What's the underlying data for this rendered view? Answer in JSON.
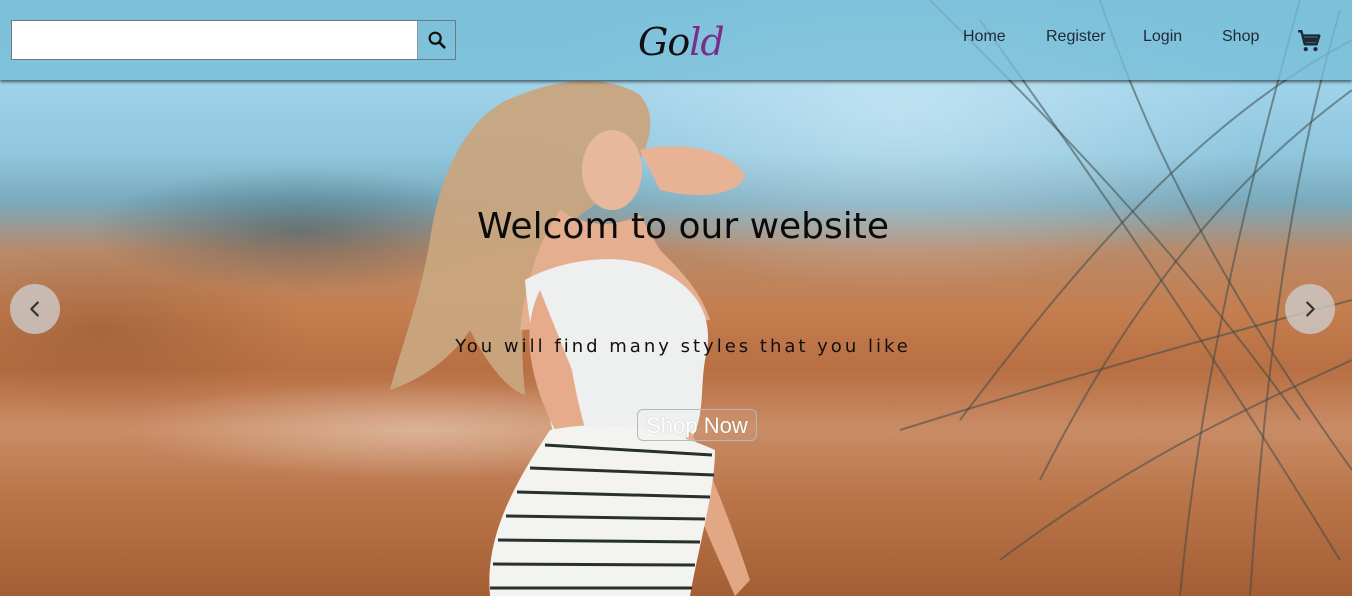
{
  "header": {
    "search": {
      "value": "",
      "placeholder": "",
      "button_icon": "search-icon"
    },
    "logo": {
      "part1": "Go",
      "part2": "ld",
      "colors": {
        "part1": "#111111",
        "part2": "#7b2d8c"
      }
    },
    "nav": {
      "home": "Home",
      "register": "Register",
      "login": "Login",
      "shop": "Shop"
    },
    "cart_icon": "shopping-cart-icon"
  },
  "hero": {
    "title": "Welcom to our website",
    "subtitle": "You will find many styles that you like",
    "cta_label": "Shop Now",
    "prev_icon": "chevron-left-icon",
    "next_icon": "chevron-right-icon"
  }
}
